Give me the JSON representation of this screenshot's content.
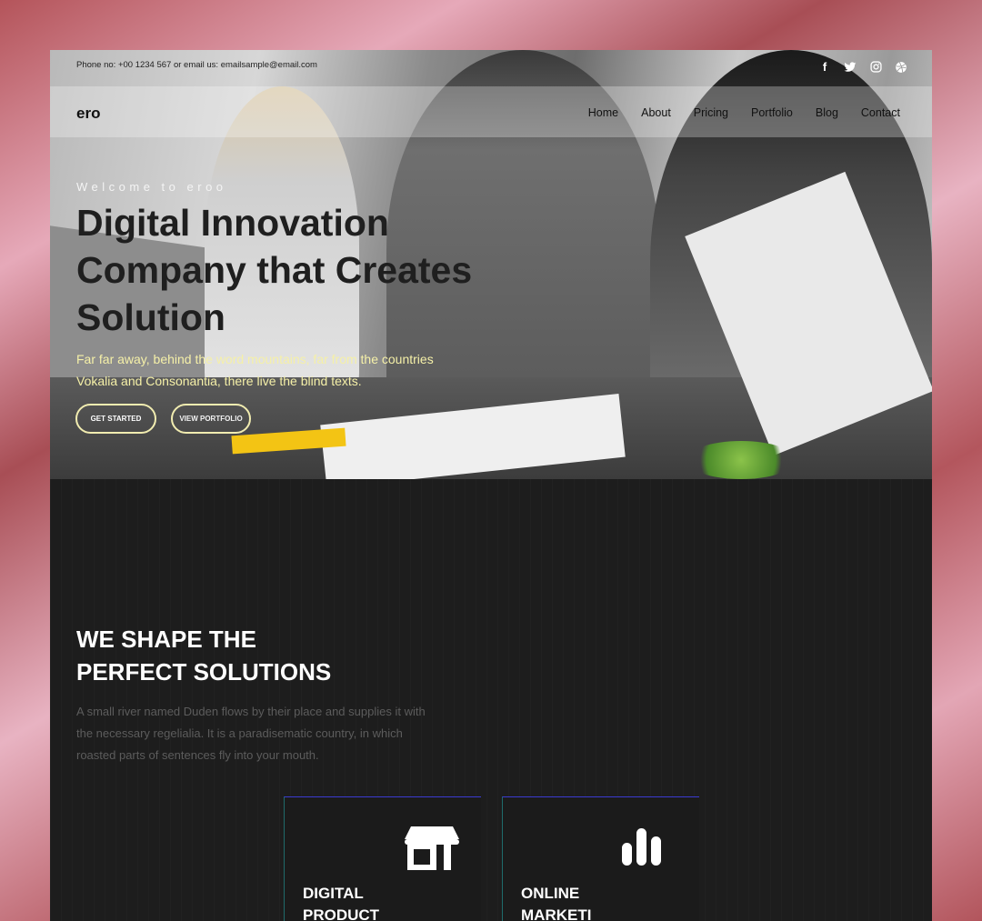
{
  "topbar": {
    "contact": "Phone no: +00 1234 567 or email us: emailsample@email.com",
    "social": [
      "facebook-icon",
      "twitter-icon",
      "instagram-icon",
      "dribbble-icon"
    ]
  },
  "navbar": {
    "brand": "ero",
    "items": [
      "Home",
      "About",
      "Pricing",
      "Portfolio",
      "Blog",
      "Contact"
    ]
  },
  "hero": {
    "welcome": "Welcome to eroo",
    "title": "Digital Innovation Company that Creates Solution",
    "text": "Far far away, behind the word mountains, far from the countries Vokalia and Consonantia, there live the blind texts.",
    "btn_primary": "GET STARTED",
    "btn_secondary": "VIEW PORTFOLIO"
  },
  "about": {
    "title_line1": "WE SHAPE THE",
    "title_line2": "PERFECT SOLUTIONS",
    "text": "A small river named Duden flows by their place and supplies it with the necessary regelialia. It is a paradisematic country, in which roasted parts of sentences fly into your mouth."
  },
  "cards": [
    {
      "icon": "storefront-icon",
      "title_line1": "DIGITAL",
      "title_line2": "PRODUCT"
    },
    {
      "icon": "bar-chart-icon",
      "title_line1": "ONLINE",
      "title_line2": "MARKETI"
    }
  ],
  "colors": {
    "accent_yellow": "#f5f0a8",
    "dark_bg": "#1d1d1d",
    "card_border": "#3b3bd2"
  }
}
